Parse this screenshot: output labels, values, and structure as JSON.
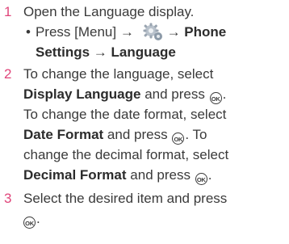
{
  "steps": [
    {
      "number": "1",
      "text": "Open the Language display."
    },
    {
      "number": "2"
    },
    {
      "number": "3"
    }
  ],
  "sub": {
    "bullet": "•",
    "press_menu": "Press [Menu] →",
    "settings_icon": "settings-gear-icon",
    "arrow": "→",
    "phone_settings_a": "Phone",
    "phone_settings_b": "Settings",
    "arrow2": "→",
    "language": "Language"
  },
  "step2": {
    "l1": "To change the language, select",
    "display_language": "Display Language",
    "and_press": "and press",
    "l3": "To change the date format, select",
    "date_format": "Date Format",
    "and_press2": "and press",
    "to": ". To",
    "l5": "change the decimal format, select",
    "decimal_format": "Decimal Format",
    "and_press3": "and press"
  },
  "step3": {
    "l1": "Select the desired item and press"
  },
  "ok_label": "OK",
  "colors": {
    "step_number": "#e0457a",
    "text": "#3a3a3a"
  }
}
